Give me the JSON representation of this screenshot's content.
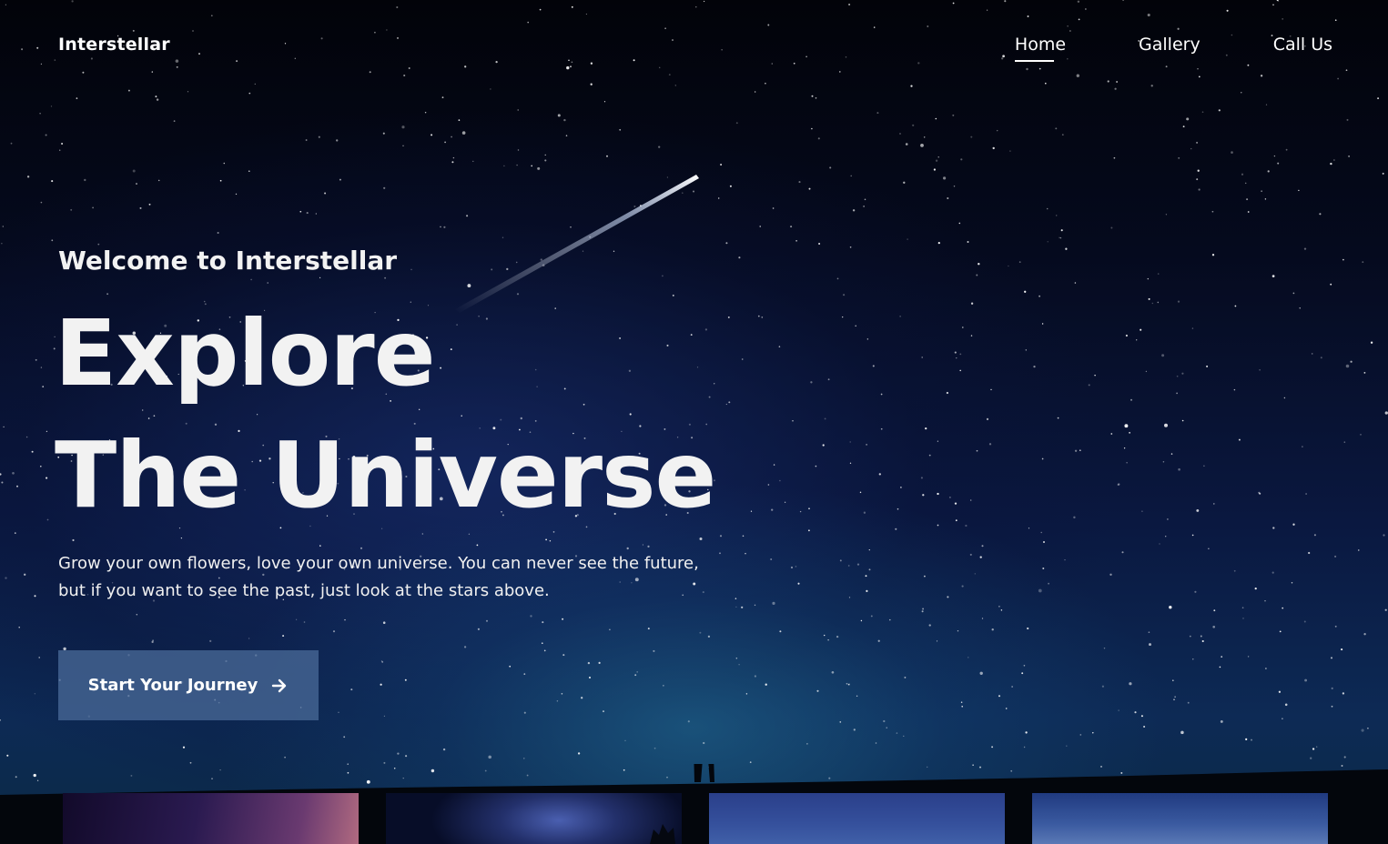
{
  "nav": {
    "brand": "Interstellar",
    "links": [
      {
        "label": "Home",
        "active": true
      },
      {
        "label": "Gallery",
        "active": false
      },
      {
        "label": "Call Us",
        "active": false
      }
    ]
  },
  "hero": {
    "welcome": "Welcome to Interstellar",
    "title_line1": "Explore",
    "title_line2": "The Universe",
    "description": "Grow your own flowers, love your own universe. You can never see the future, but if you want to see the past, just look at the stars above.",
    "cta_label": "Start Your Journey",
    "cta_icon": "arrow-right-icon"
  },
  "gallery": {
    "thumbnail_count": 4
  },
  "colors": {
    "text": "#ffffff",
    "cta_background": "#486896",
    "sky_dark": "#02040c",
    "sky_blue": "#0d2a55"
  }
}
